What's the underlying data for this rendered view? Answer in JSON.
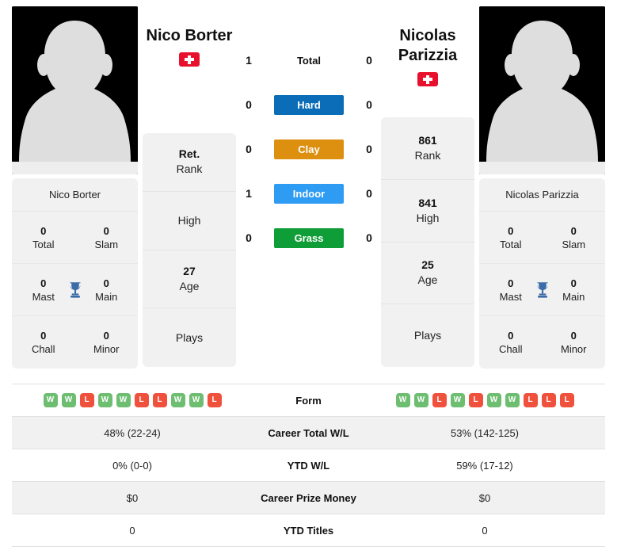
{
  "players": {
    "left": {
      "name": "Nico Borter",
      "flag": "swiss-flag",
      "card_name": "Nico Borter",
      "trophies": {
        "total": "0",
        "total_label": "Total",
        "slam": "0",
        "slam_label": "Slam",
        "mast": "0",
        "mast_label": "Mast",
        "main": "0",
        "main_label": "Main",
        "chall": "0",
        "chall_label": "Chall",
        "minor": "0",
        "minor_label": "Minor"
      },
      "info": {
        "rank_value": "Ret.",
        "rank_label": "Rank",
        "high_value": "",
        "high_label": "High",
        "age_value": "27",
        "age_label": "Age",
        "plays_value": "",
        "plays_label": "Plays"
      }
    },
    "right": {
      "name": "Nicolas Parizzia",
      "name_line1": "Nicolas",
      "name_line2": "Parizzia",
      "flag": "swiss-flag",
      "card_name": "Nicolas Parizzia",
      "trophies": {
        "total": "0",
        "total_label": "Total",
        "slam": "0",
        "slam_label": "Slam",
        "mast": "0",
        "mast_label": "Mast",
        "main": "0",
        "main_label": "Main",
        "chall": "0",
        "chall_label": "Chall",
        "minor": "0",
        "minor_label": "Minor"
      },
      "info": {
        "rank_value": "861",
        "rank_label": "Rank",
        "high_value": "841",
        "high_label": "High",
        "age_value": "25",
        "age_label": "Age",
        "plays_value": "",
        "plays_label": "Plays"
      }
    }
  },
  "h2h": {
    "rows": [
      {
        "label": "Total",
        "left": "1",
        "right": "0",
        "style": "plain",
        "color": ""
      },
      {
        "label": "Hard",
        "left": "0",
        "right": "0",
        "style": "badge",
        "color": "#0b6cb8"
      },
      {
        "label": "Clay",
        "left": "0",
        "right": "0",
        "style": "badge",
        "color": "#dd9010"
      },
      {
        "label": "Indoor",
        "left": "1",
        "right": "0",
        "style": "badge",
        "color": "#2f9cf4"
      },
      {
        "label": "Grass",
        "left": "0",
        "right": "0",
        "style": "badge",
        "color": "#0f9d38"
      }
    ]
  },
  "stats_table": {
    "rows": [
      {
        "label": "Form",
        "type": "form",
        "left_form": [
          "W",
          "W",
          "L",
          "W",
          "W",
          "L",
          "L",
          "W",
          "W",
          "L"
        ],
        "right_form": [
          "W",
          "W",
          "L",
          "W",
          "L",
          "W",
          "W",
          "L",
          "L",
          "L"
        ],
        "shaded": false
      },
      {
        "label": "Career Total W/L",
        "type": "text",
        "left": "48% (22-24)",
        "right": "53% (142-125)",
        "shaded": true
      },
      {
        "label": "YTD W/L",
        "type": "text",
        "left": "0% (0-0)",
        "right": "59% (17-12)",
        "shaded": false
      },
      {
        "label": "Career Prize Money",
        "type": "text",
        "left": "$0",
        "right": "$0",
        "shaded": true
      },
      {
        "label": "YTD Titles",
        "type": "text",
        "left": "0",
        "right": "0",
        "shaded": false
      }
    ]
  },
  "colors": {
    "win": "#6ebe72",
    "loss": "#ef513c",
    "trophy": "#3b6ca8",
    "card_bg": "#f1f1f1",
    "flag_red": "#e8112d"
  },
  "icons": {
    "avatar": "person-silhouette-icon",
    "trophy": "trophy-icon",
    "flag": "swiss-flag-icon"
  }
}
